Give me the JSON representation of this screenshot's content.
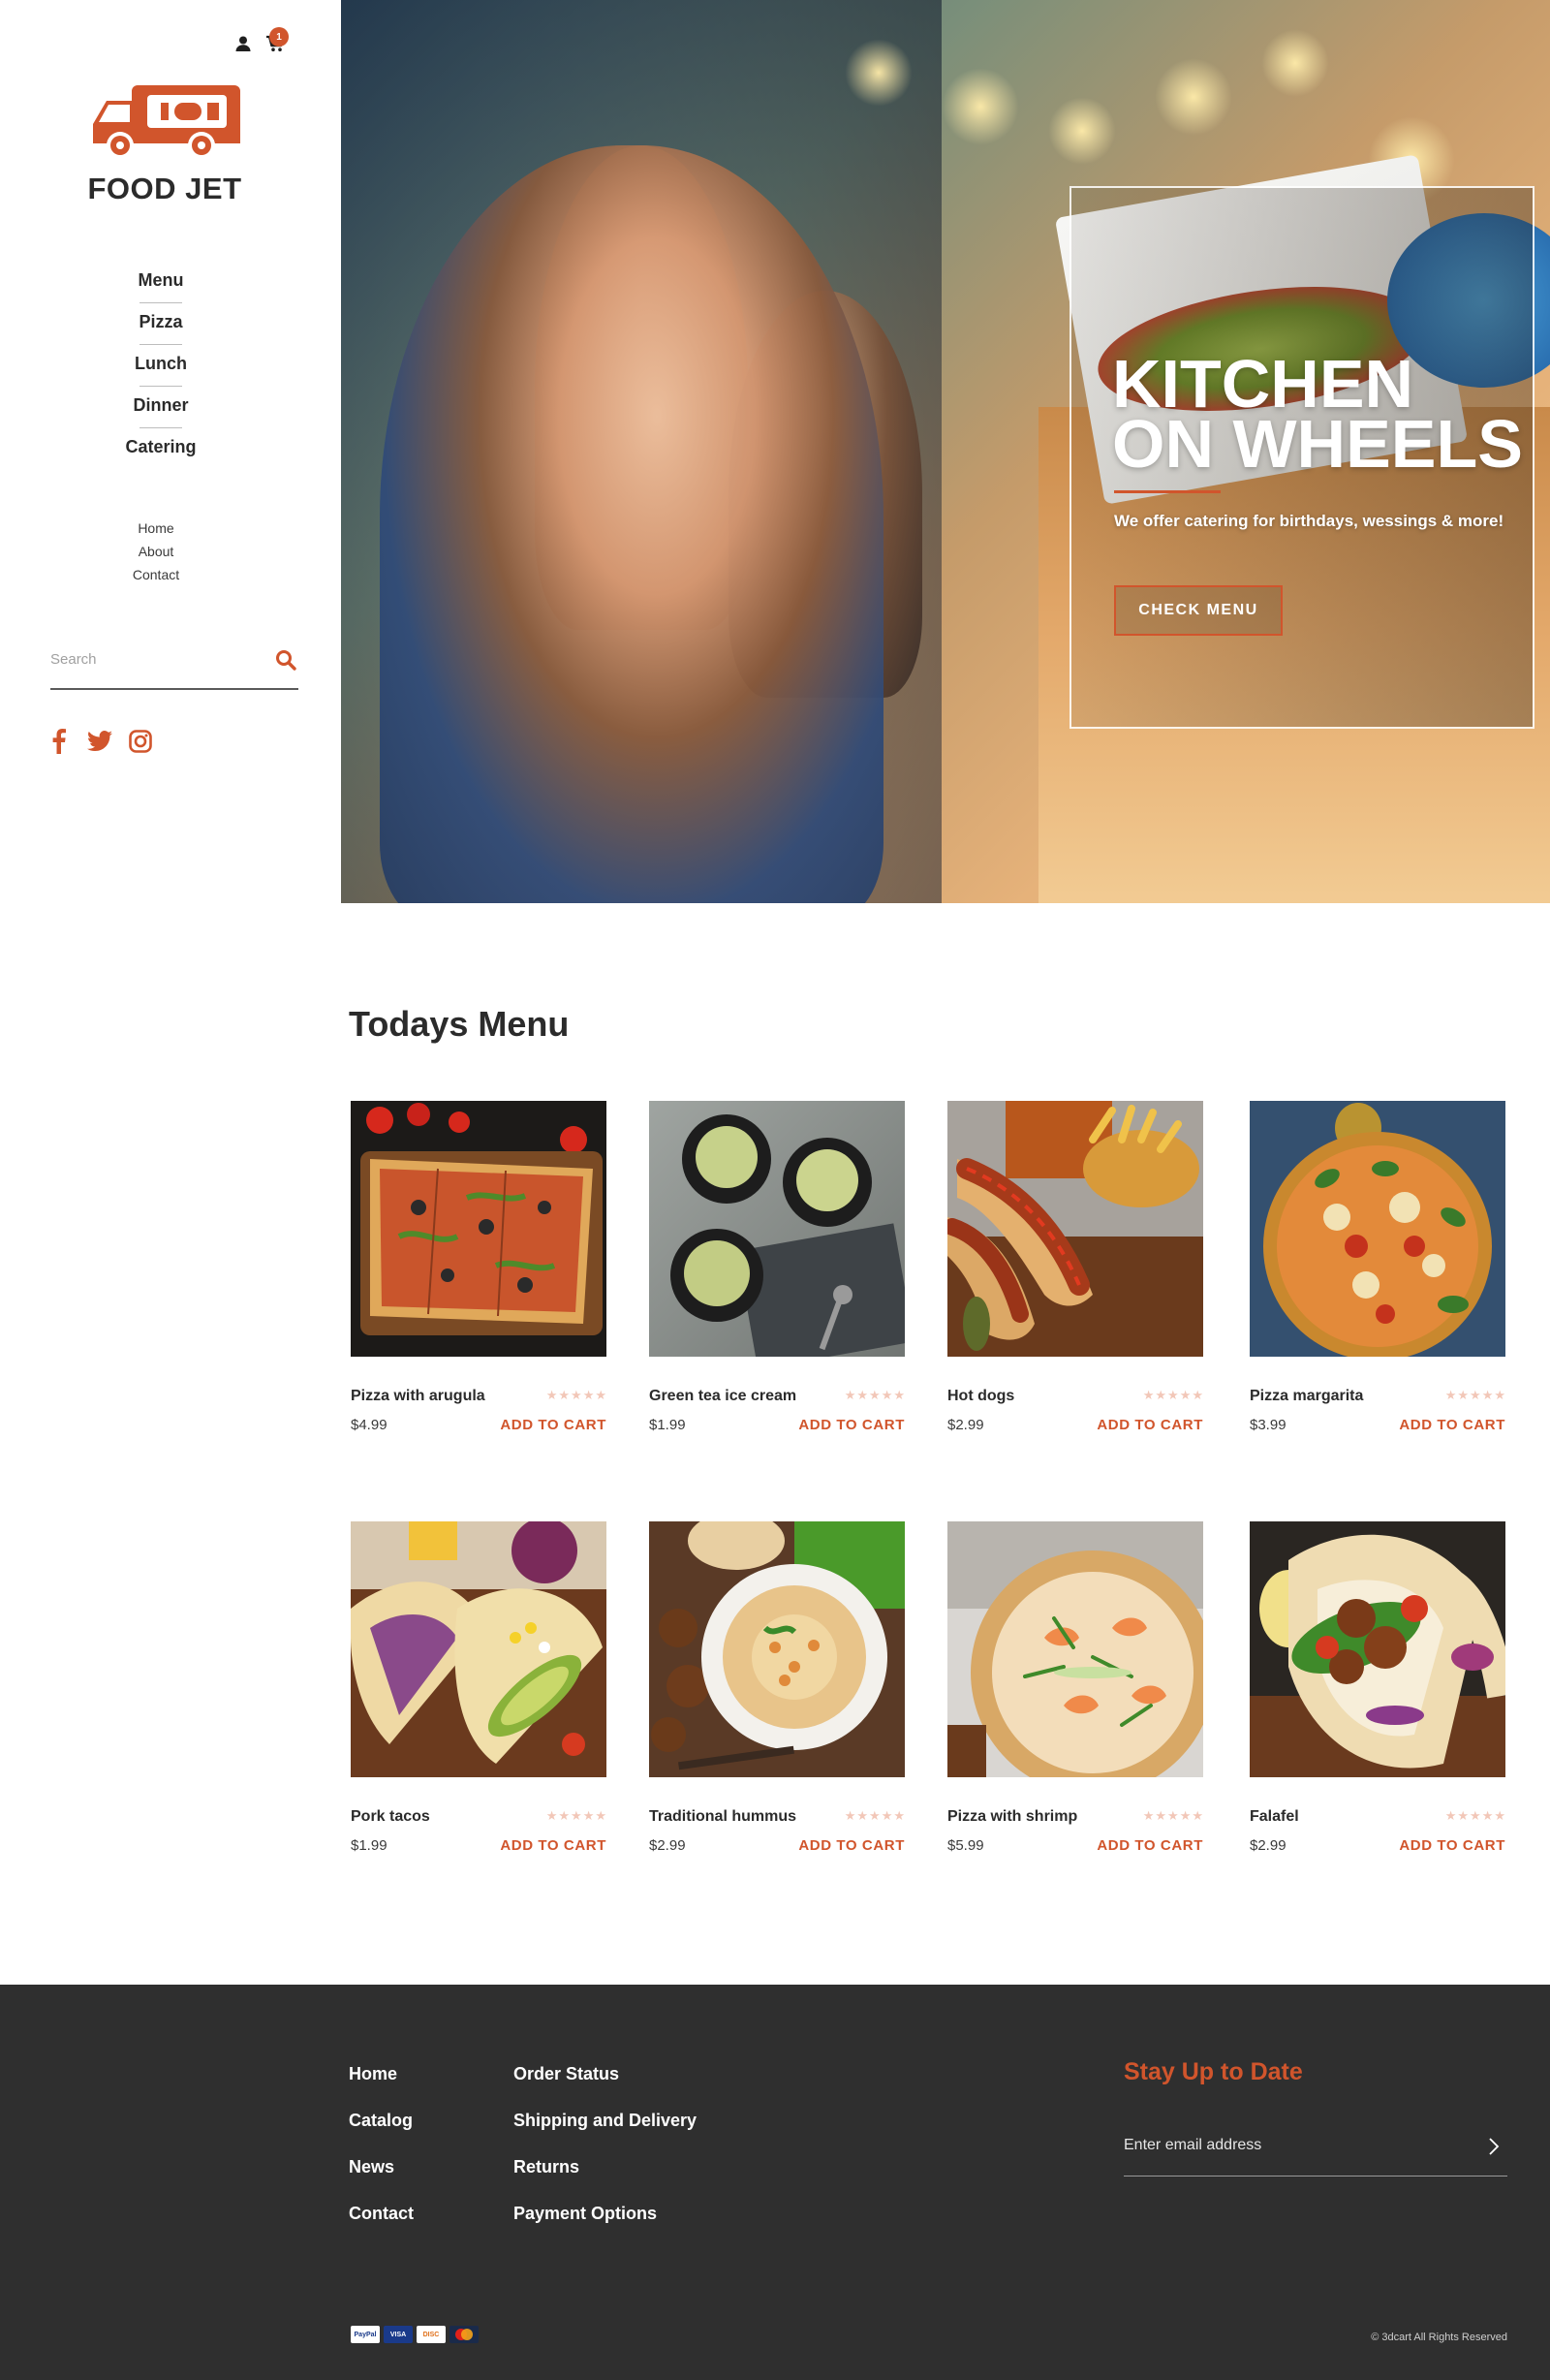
{
  "brand": {
    "name": "FOOD JET",
    "accent_color": "#d1552c",
    "cart_count": "1"
  },
  "sidebar": {
    "primary_nav": [
      "Menu",
      "Pizza",
      "Lunch",
      "Dinner",
      "Catering"
    ],
    "secondary_nav": [
      "Home",
      "About",
      "Contact"
    ],
    "search": {
      "placeholder": "Search",
      "icon": "search-icon"
    },
    "social": [
      "facebook-icon",
      "twitter-icon",
      "instagram-icon"
    ]
  },
  "hero": {
    "title_line_1": "KITCHEN",
    "title_line_2": "ON WHEELS",
    "subtitle": "We offer catering for birthdays, wessings & more!",
    "cta_label": "CHECK MENU"
  },
  "menu": {
    "title": "Todays Menu",
    "add_label": "ADD TO CART",
    "products": [
      {
        "name": "Pizza with arugula",
        "price": "$4.99",
        "rating": 0,
        "image": "pizza-arugula"
      },
      {
        "name": "Green tea ice cream",
        "price": "$1.99",
        "rating": 0,
        "image": "green-tea-ice-cream"
      },
      {
        "name": "Hot dogs",
        "price": "$2.99",
        "rating": 0,
        "image": "hot-dogs"
      },
      {
        "name": "Pizza margarita",
        "price": "$3.99",
        "rating": 0,
        "image": "pizza-margarita"
      },
      {
        "name": "Pork tacos",
        "price": "$1.99",
        "rating": 0,
        "image": "pork-tacos"
      },
      {
        "name": "Traditional hummus",
        "price": "$2.99",
        "rating": 0,
        "image": "hummus"
      },
      {
        "name": "Pizza with shrimp",
        "price": "$5.99",
        "rating": 0,
        "image": "pizza-shrimp"
      },
      {
        "name": "Falafel",
        "price": "$2.99",
        "rating": 0,
        "image": "falafel"
      }
    ]
  },
  "footer": {
    "col1": [
      "Home",
      "Catalog",
      "News",
      "Contact"
    ],
    "col2": [
      "Order Status",
      "Shipping and Delivery",
      "Returns",
      "Payment Options"
    ],
    "newsletter_title": "Stay Up to Date",
    "newsletter_placeholder": "Enter email address",
    "payments": [
      "PayPal",
      "VISA",
      "DISCOVER",
      "MC"
    ],
    "copyright": "© 3dcart All Rights Reserved"
  }
}
